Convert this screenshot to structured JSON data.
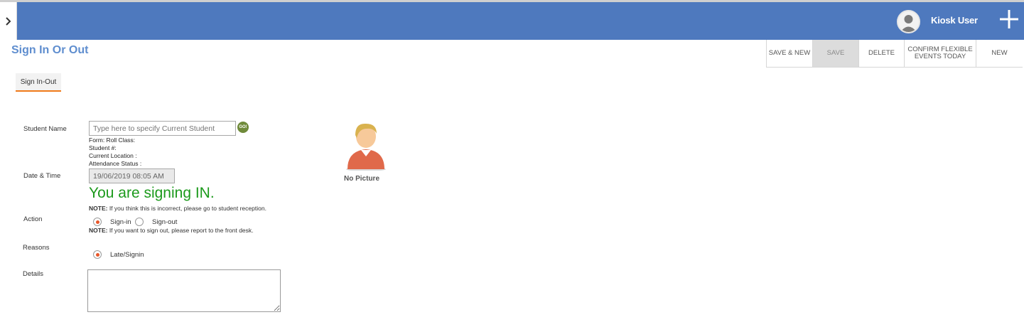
{
  "header": {
    "user_name": "Kiosk User",
    "bar_color": "#4e79be",
    "icons": {
      "toggle": "chevron-right-icon",
      "avatar": "user-avatar-icon",
      "add": "plus-icon"
    }
  },
  "page": {
    "title": "Sign In Or Out"
  },
  "toolbar": {
    "buttons": [
      {
        "label": "SAVE & NEW",
        "active": false
      },
      {
        "label": "SAVE",
        "active": true
      },
      {
        "label": "DELETE",
        "active": false
      },
      {
        "label": "CONFIRM FLEXIBLE EVENTS TODAY",
        "active": false
      },
      {
        "label": "NEW",
        "active": false
      }
    ]
  },
  "tabs": [
    {
      "label": "Sign In-Out",
      "active": true
    }
  ],
  "form": {
    "student_name": {
      "label": "Student Name",
      "placeholder": "Type here to specify Current Student",
      "go_label": "GO!"
    },
    "student_info": {
      "form_line": "Form:   Roll Class:",
      "student_number": "Student #:",
      "current_location": "Current Location :",
      "attendance_status": "Attendance Status :"
    },
    "date_time": {
      "label": "Date & Time",
      "value": "19/06/2019 08:05 AM"
    },
    "signing_message": "You are signing IN.",
    "signing_message_color": "#1c9a1c",
    "note_incorrect": {
      "prefix": "NOTE:",
      "text": " If you think this is incorrect, please go to student reception."
    },
    "action": {
      "label": "Action",
      "options": [
        {
          "label": "Sign-in",
          "checked": true
        },
        {
          "label": "Sign-out",
          "checked": false
        }
      ],
      "note": {
        "prefix": "NOTE:",
        "text": " If you want to sign out, please report to the front desk."
      }
    },
    "reasons": {
      "label": "Reasons",
      "options": [
        {
          "label": "Late/Signin",
          "checked": true
        }
      ]
    },
    "details": {
      "label": "Details",
      "value": ""
    }
  },
  "picture": {
    "label": "No Picture",
    "icon": "no-picture-person-icon"
  }
}
